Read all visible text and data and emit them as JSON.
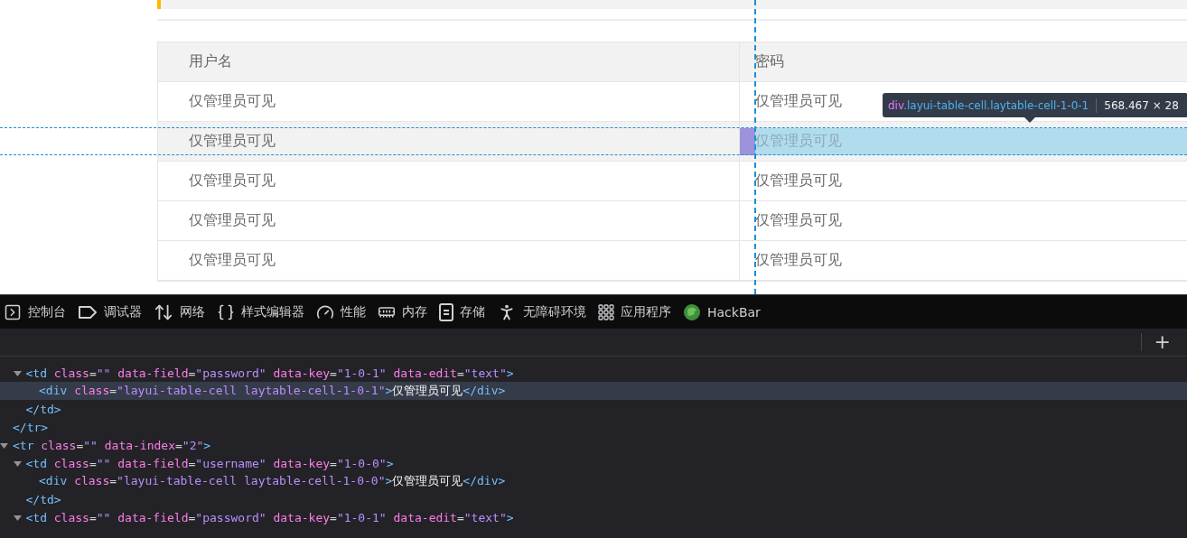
{
  "page": {
    "table": {
      "columns": [
        "用户名",
        "密码"
      ],
      "rows": [
        {
          "hovered": false,
          "cells": [
            {
              "text": "仅管理员可见",
              "inspected": false
            },
            {
              "text": "仅管理员可见",
              "inspected": false
            }
          ]
        },
        {
          "hovered": true,
          "cells": [
            {
              "text": "仅管理员可见",
              "inspected": false
            },
            {
              "text": "仅管理员可见",
              "inspected": true
            }
          ]
        },
        {
          "hovered": false,
          "cells": [
            {
              "text": "仅管理员可见",
              "inspected": false
            },
            {
              "text": "仅管理员可见",
              "inspected": false
            }
          ]
        },
        {
          "hovered": false,
          "cells": [
            {
              "text": "仅管理员可见",
              "inspected": false
            },
            {
              "text": "仅管理员可见",
              "inspected": false
            }
          ]
        },
        {
          "hovered": false,
          "cells": [
            {
              "text": "仅管理员可见",
              "inspected": false
            },
            {
              "text": "仅管理员可见",
              "inspected": false
            }
          ]
        }
      ]
    },
    "inspector_tooltip": {
      "tag": "div",
      "classes": ".layui-table-cell.laytable-cell-1-0-1",
      "size": "568.467 × 28"
    }
  },
  "devtools": {
    "tabs": [
      {
        "label": "控制台"
      },
      {
        "label": "调试器"
      },
      {
        "label": "网络"
      },
      {
        "label": "样式编辑器"
      },
      {
        "label": "性能"
      },
      {
        "label": "内存"
      },
      {
        "label": "存储"
      },
      {
        "label": "无障碍环境"
      },
      {
        "label": "应用程序"
      },
      {
        "label": "HackBar"
      }
    ],
    "add_button": "+",
    "dom_tree": [
      {
        "kind": "offscreen",
        "children": [
          {
            "kind": "open",
            "selected": false,
            "expanded": true,
            "tag": "<td",
            "close": ">",
            "attributes": [
              {
                "name": "class",
                "eq": "=",
                "value": "\"\""
              },
              {
                "name": "data-field",
                "eq": "=",
                "value": "\"password\""
              },
              {
                "name": "data-key",
                "eq": "=",
                "value": "\"1-0-1\""
              },
              {
                "name": "data-edit",
                "eq": "=",
                "value": "\"text\""
              }
            ],
            "children": [
              {
                "kind": "inline",
                "selected": true,
                "tag": "<div",
                "close": ">",
                "attributes": [
                  {
                    "name": "class",
                    "eq": "=",
                    "value": "\"layui-table-cell laytable-cell-1-0-1\""
                  }
                ],
                "text": "仅管理员可见",
                "end_tag": "</div>"
              }
            ]
          },
          {
            "kind": "close",
            "selected": false,
            "tag": "</td>"
          }
        ]
      },
      {
        "kind": "close",
        "selected": false,
        "tag": "</tr>"
      },
      {
        "kind": "open",
        "selected": false,
        "expanded": true,
        "tag": "<tr",
        "close": ">",
        "attributes": [
          {
            "name": "class",
            "eq": "=",
            "value": "\"\""
          },
          {
            "name": "data-index",
            "eq": "=",
            "value": "\"2\""
          }
        ],
        "children": [
          {
            "kind": "open",
            "selected": false,
            "expanded": true,
            "tag": "<td",
            "close": ">",
            "attributes": [
              {
                "name": "class",
                "eq": "=",
                "value": "\"\""
              },
              {
                "name": "data-field",
                "eq": "=",
                "value": "\"username\""
              },
              {
                "name": "data-key",
                "eq": "=",
                "value": "\"1-0-0\""
              }
            ],
            "children": [
              {
                "kind": "inline",
                "selected": false,
                "tag": "<div",
                "close": ">",
                "attributes": [
                  {
                    "name": "class",
                    "eq": "=",
                    "value": "\"layui-table-cell laytable-cell-1-0-0\""
                  }
                ],
                "text": "仅管理员可见",
                "end_tag": "</div>"
              }
            ]
          },
          {
            "kind": "close",
            "selected": false,
            "tag": "</td>"
          },
          {
            "kind": "open",
            "selected": false,
            "expanded": true,
            "tag": "<td",
            "close": ">",
            "attributes": [
              {
                "name": "class",
                "eq": "=",
                "value": "\"\""
              },
              {
                "name": "data-field",
                "eq": "=",
                "value": "\"password\""
              },
              {
                "name": "data-key",
                "eq": "=",
                "value": "\"1-0-1\""
              },
              {
                "name": "data-edit",
                "eq": "=",
                "value": "\"text\""
              }
            ]
          }
        ]
      }
    ]
  }
}
